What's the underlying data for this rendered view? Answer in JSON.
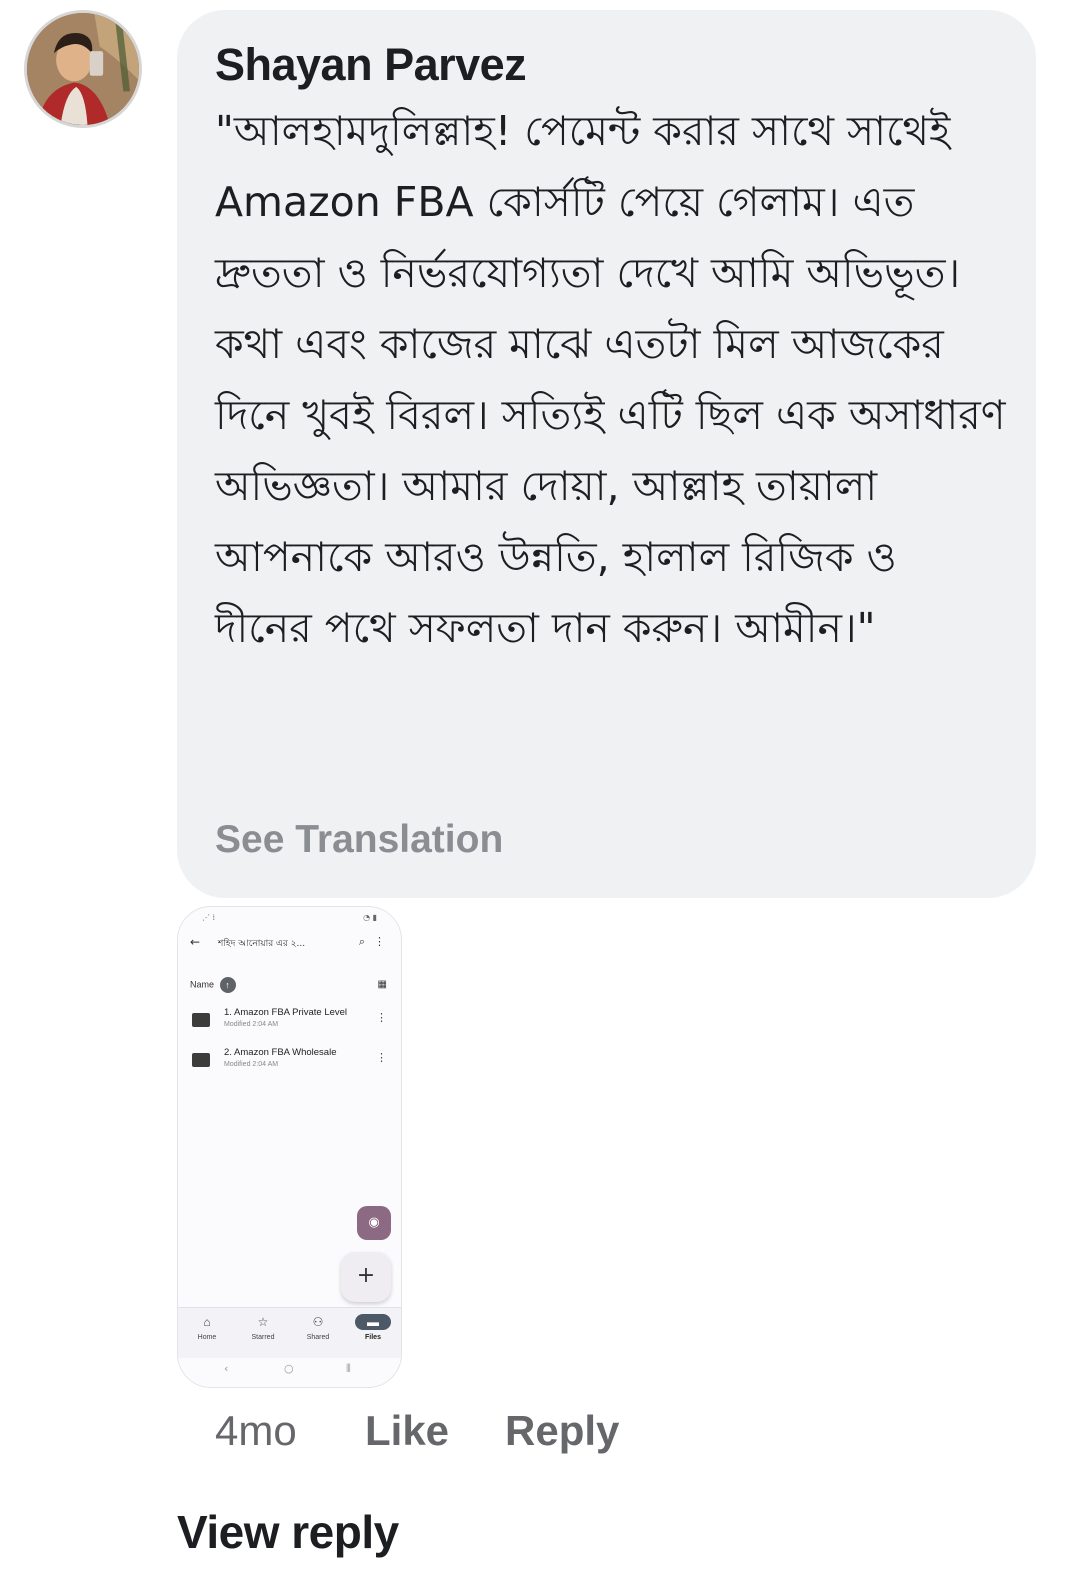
{
  "comment": {
    "author": "Shayan Parvez",
    "text": "\"আলহামদুলিল্লাহ! পেমেন্ট করার সাথে সাথেই Amazon FBA কোর্সটি পেয়ে গেলাম। এত দ্রুততা ও নির্ভরযোগ্যতা দেখে আমি অভিভূত। কথা এবং কাজের মাঝে এতটা মিল আজকের দিনে খুবই বিরল। সত্যিই এটি ছিল এক অসাধারণ অভিজ্ঞতা। আমার দোয়া, আল্লাহ তায়ালা আপনাকে আরও উন্নতি, হালাল রিজিক ও দীনের পথে সফলতা দান করুন। আমীন।\"",
    "see_translation": "See Translation",
    "time": "4mo",
    "like_label": "Like",
    "reply_label": "Reply",
    "view_reply_label": "View reply"
  },
  "attachment": {
    "topbar_title": "শহিদ আনোয়ার এর ২...",
    "sort_label": "Name",
    "files": [
      {
        "name": "1. Amazon FBA Private Level",
        "modified": "Modified 2:04 AM"
      },
      {
        "name": "2. Amazon FBA Wholesale",
        "modified": "Modified 2:04 AM"
      }
    ],
    "nav": [
      {
        "label": "Home",
        "icon": "home-icon"
      },
      {
        "label": "Starred",
        "icon": "star-icon"
      },
      {
        "label": "Shared",
        "icon": "shared-icon"
      },
      {
        "label": "Files",
        "icon": "folder-icon"
      }
    ]
  },
  "colors": {
    "bubble_bg": "#eff1f3",
    "text_primary": "#1c1e21",
    "text_secondary": "#65676b",
    "translation_gray": "#8a8d91"
  }
}
